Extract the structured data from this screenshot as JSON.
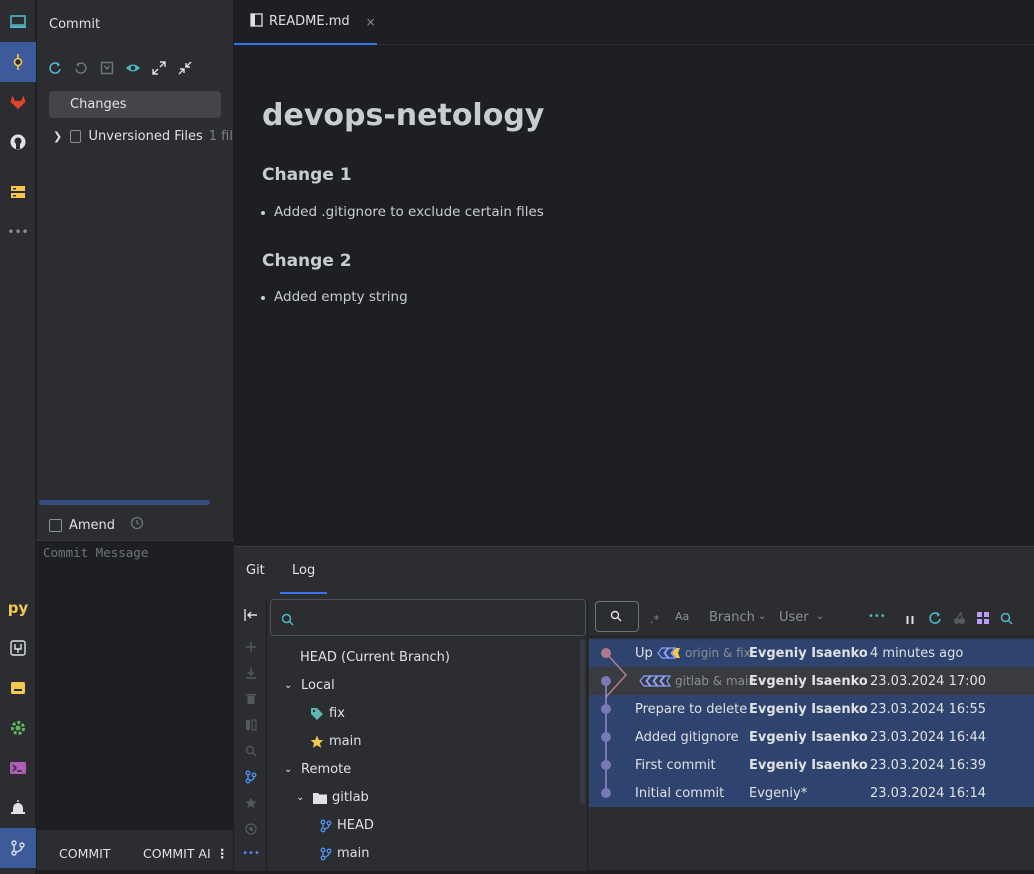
{
  "strip": {
    "icons": [
      "project-icon",
      "commit-icon",
      "gitlab-icon",
      "github-icon",
      "database-icon",
      "more-icon",
      "python-icon",
      "services-icon",
      "terminal-folder-icon",
      "settings-icon",
      "terminal-icon",
      "notifications-icon",
      "git-branch-icon"
    ],
    "py_label": "py",
    "more_label": "•••"
  },
  "commit": {
    "title": "Commit",
    "changes": "Changes",
    "unversioned": "Unversioned Files",
    "unversioned_count": "1 fil",
    "amend": "Amend",
    "message_placeholder": "Commit Message",
    "commit_btn": "COMMIT",
    "commit_all_btn": "COMMIT AI",
    "kebab": "⋮"
  },
  "editor": {
    "tab_label": "README.md",
    "close": "×",
    "h1": "devops-netology",
    "sections": [
      {
        "heading": "Change 1",
        "item": "Added .gitignore to exclude certain files"
      },
      {
        "heading": "Change 2",
        "item": "Added empty string"
      }
    ]
  },
  "bottom": {
    "tabs": [
      "Git",
      "Log"
    ],
    "branches": {
      "head": "HEAD (Current Branch)",
      "local": "Local",
      "local_items": [
        "fix",
        "main"
      ],
      "remote": "Remote",
      "remote_group": "gitlab",
      "remote_items": [
        "HEAD",
        "main"
      ]
    }
  },
  "log": {
    "branch_filter": "Branch",
    "user_filter": "User",
    "case_label": "Aa",
    "more": "•••",
    "rows": [
      {
        "msg": "Up",
        "refs": "origin & fix",
        "author": "Evgeniy Isaenkov",
        "date": "4 minutes ago",
        "bold": true
      },
      {
        "msg": "",
        "refs": "gitlab & main",
        "author": "Evgeniy Isaenkov",
        "date": "23.03.2024 17:00",
        "bold": true
      },
      {
        "msg": "Prepare to delete",
        "refs": "",
        "author": "Evgeniy Isaenkov",
        "date": "23.03.2024 16:55",
        "bold": true
      },
      {
        "msg": "Added gitignore",
        "refs": "",
        "author": "Evgeniy Isaenkov",
        "date": "23.03.2024 16:44",
        "bold": true
      },
      {
        "msg": "First commit",
        "refs": "",
        "author": "Evgeniy Isaenkov",
        "date": "23.03.2024 16:39",
        "bold": true
      },
      {
        "msg": "Initial commit",
        "refs": "",
        "author": "Evgeniy*",
        "date": "23.03.2024 16:14",
        "bold": false
      }
    ]
  },
  "colors": {
    "accent": "#3574f0",
    "selection": "#2e436e",
    "graph_main": "#7a78b5",
    "graph_top": "#b07a8e",
    "tag": "#5fb8b4",
    "star": "#f2c94c"
  }
}
